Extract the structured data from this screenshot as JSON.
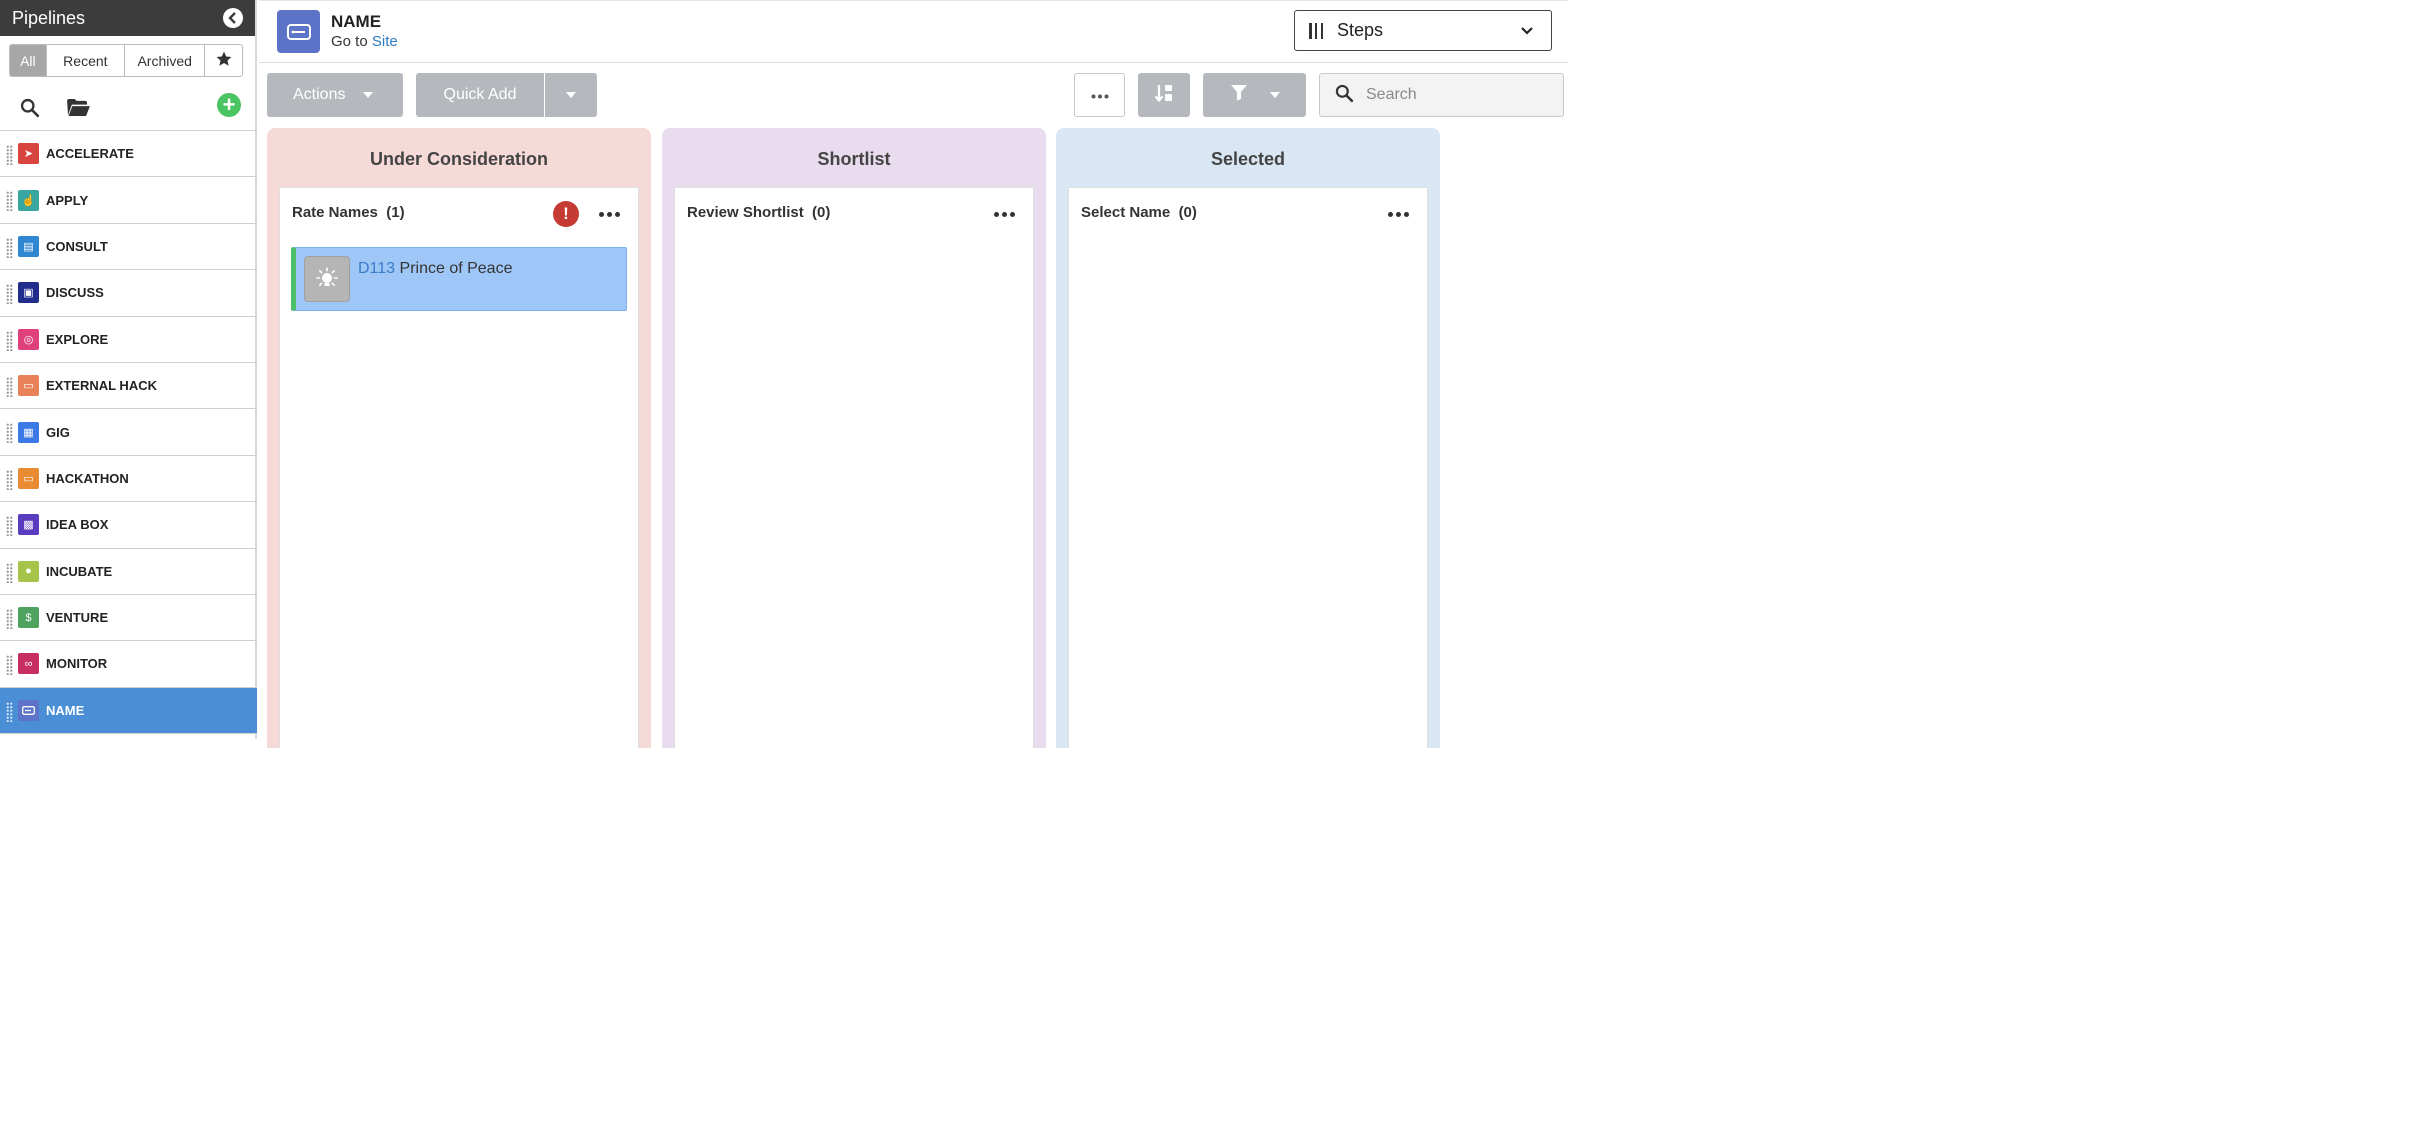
{
  "sidebar": {
    "title": "Pipelines",
    "tabs": [
      {
        "label": "All"
      },
      {
        "label": "Recent"
      },
      {
        "label": "Archived"
      }
    ],
    "items": [
      {
        "label": "ACCELERATE",
        "color": "#d8453e",
        "icon": "rocket-icon"
      },
      {
        "label": "APPLY",
        "color": "#3aa6a1",
        "icon": "hand-pointer-icon"
      },
      {
        "label": "CONSULT",
        "color": "#2f86d1",
        "icon": "clipboard-icon"
      },
      {
        "label": "DISCUSS",
        "color": "#1e2e8a",
        "icon": "chat-bubbles-icon"
      },
      {
        "label": "EXPLORE",
        "color": "#e0417a",
        "icon": "compass-icon"
      },
      {
        "label": "EXTERNAL HACK",
        "color": "#e98258",
        "icon": "laptop-icon"
      },
      {
        "label": "GIG",
        "color": "#3b79e6",
        "icon": "calendar-icon"
      },
      {
        "label": "HACKATHON",
        "color": "#e88b33",
        "icon": "laptop-icon"
      },
      {
        "label": "IDEA BOX",
        "color": "#5a3cbf",
        "icon": "idea-box-icon"
      },
      {
        "label": "INCUBATE",
        "color": "#a7c44a",
        "icon": "flame-icon"
      },
      {
        "label": "VENTURE",
        "color": "#4ea35e",
        "icon": "money-bag-icon"
      },
      {
        "label": "MONITOR",
        "color": "#c72f62",
        "icon": "binoculars-icon"
      },
      {
        "label": "NAME",
        "color": "#5d73c8",
        "icon": "name-tag-icon"
      }
    ],
    "active_item": "NAME"
  },
  "header": {
    "title": "NAME",
    "goto_text": "Go to",
    "goto_link": "Site",
    "view_selector": "Steps"
  },
  "toolbar": {
    "actions_label": "Actions",
    "quick_add_label": "Quick Add",
    "search_placeholder": "Search"
  },
  "columns": [
    {
      "title": "Under Consideration",
      "bg": "#f6dad7",
      "step": "Rate Names",
      "count": "(1)",
      "has_alert": true,
      "cards": [
        {
          "id": "D113",
          "title": "Prince of Peace",
          "icon": "lightbulb-icon"
        }
      ]
    },
    {
      "title": "Shortlist",
      "bg": "#e8dcee",
      "step": "Review Shortlist",
      "count": "(0)",
      "has_alert": false,
      "cards": []
    },
    {
      "title": "Selected",
      "bg": "#d9e7f4",
      "step": "Select Name",
      "count": "(0)",
      "has_alert": false,
      "cards": []
    }
  ]
}
